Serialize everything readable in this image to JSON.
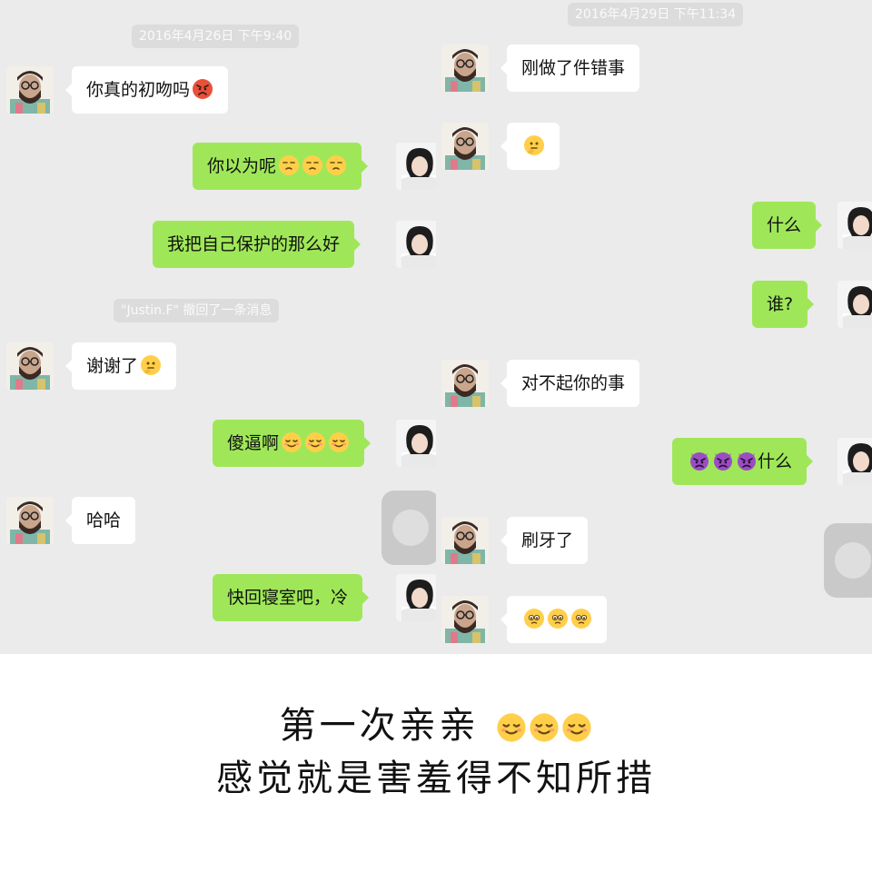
{
  "left_panel": {
    "timestamp": "2016年4月26日 下午9:40",
    "system_notice": "\"Justin.F\" 撤回了一条消息",
    "messages": [
      {
        "text": "你真的初吻吗",
        "sender": "male",
        "emoji": "angry-face"
      },
      {
        "text": "你以为呢",
        "sender": "female",
        "emoji": "unamused-face",
        "emoji_count": 3
      },
      {
        "text": "我把自己保护的那么好",
        "sender": "female"
      },
      {
        "text": "谢谢了",
        "sender": "male",
        "emoji": "thinking-face"
      },
      {
        "text": "傻逼啊",
        "sender": "female",
        "emoji": "relieved-face",
        "emoji_count": 3
      },
      {
        "text": "哈哈",
        "sender": "male"
      },
      {
        "text": "快回寝室吧，冷",
        "sender": "female"
      }
    ]
  },
  "right_panel": {
    "timestamp": "2016年4月29日 下午11:34",
    "messages": [
      {
        "text": "刚做了件错事",
        "sender": "male"
      },
      {
        "text": "",
        "sender": "male",
        "emoji": "thinking-face"
      },
      {
        "text": "什么",
        "sender": "female"
      },
      {
        "text": "谁?",
        "sender": "female"
      },
      {
        "text": "对不起你的事",
        "sender": "male"
      },
      {
        "text": "什么",
        "sender": "female",
        "emoji_prefix": "imp-face",
        "emoji_count": 3
      },
      {
        "text": "刷牙了",
        "sender": "male"
      },
      {
        "text": "",
        "sender": "male",
        "emoji": "pleading-face",
        "emoji_count": 3
      }
    ]
  },
  "caption": {
    "line1": "第一次亲亲",
    "line1_emoji": "relieved-face",
    "line1_emoji_count": 3,
    "line2": "感觉就是害羞得不知所措"
  },
  "colors": {
    "chat_background": "#ebebeb",
    "outgoing_bubble": "#9fe758",
    "incoming_bubble": "#ffffff",
    "timestamp_pill": "#dcdcdc",
    "page_background": "#ffffff"
  }
}
